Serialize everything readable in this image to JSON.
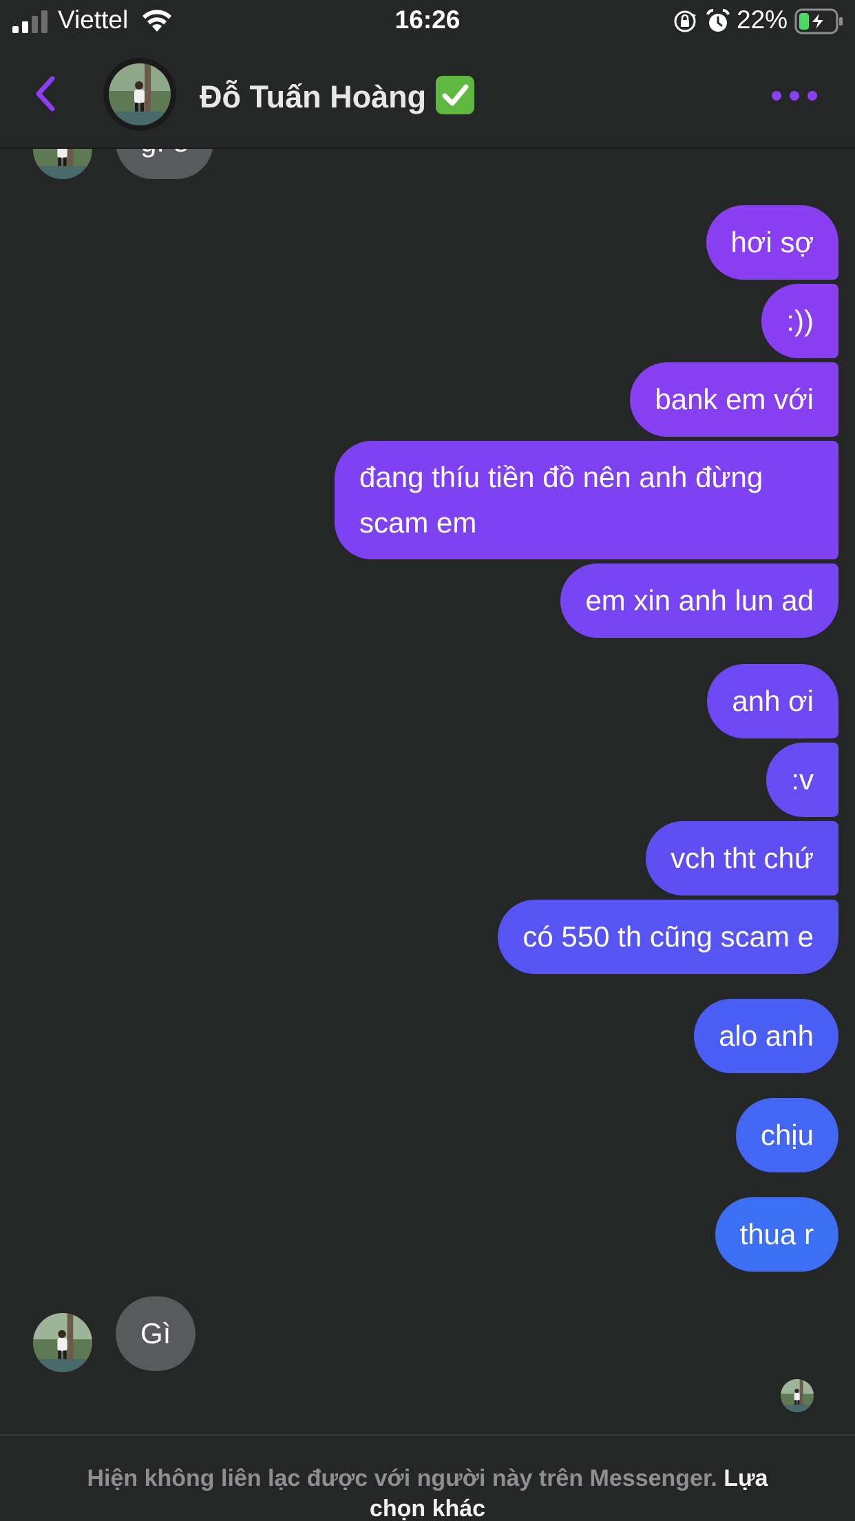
{
  "status_bar": {
    "carrier": "Viettel",
    "time": "16:26",
    "battery": "22%"
  },
  "header": {
    "contact_name": "Đỗ Tuấn Hoàng",
    "back_icon": "chevron-left-icon",
    "more_icon": "more-dots-icon",
    "verified_icon": "check-mark-button-emoji"
  },
  "conversation": {
    "prev_incoming_partial": "gì e",
    "outgoing": [
      "hơi sợ",
      ":))",
      "bank em với",
      "đang thíu tiền đồ nên anh đừng scam em",
      "em xin anh lun ad",
      "anh ơi",
      ":v",
      "vch tht chứ",
      "có 550 th cũng scam e",
      "alo anh",
      "chịu",
      "thua r"
    ],
    "incoming_last": "Gì"
  },
  "footer": {
    "notice": "Hiện không liên lạc được với người này trên Messenger.",
    "link": "Lựa chọn khác"
  },
  "colors": {
    "background": "#252626",
    "accent": "#8a3ff1",
    "bubble_top": "#8b3ff2",
    "bubble_bottom": "#3c6ff4",
    "incoming_bubble": "#595a5d"
  }
}
